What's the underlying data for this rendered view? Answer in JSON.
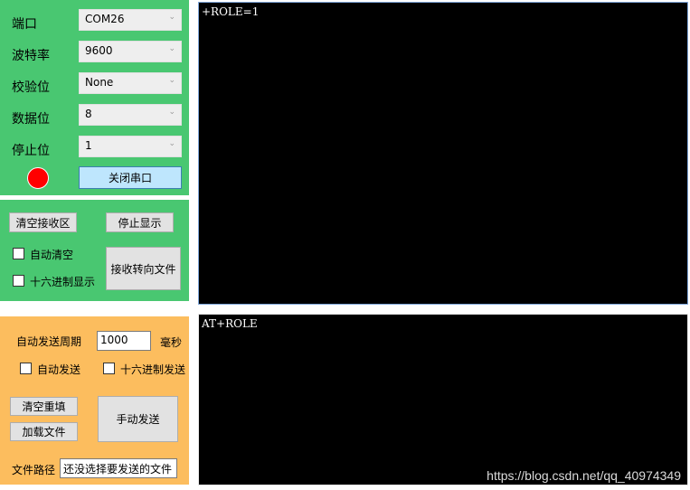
{
  "colors": {
    "panel_green": "#49c771",
    "panel_orange": "#fcbd5e",
    "terminal_bg": "#000000",
    "status_led": "#ff0000",
    "button_accent": "#bee6fd"
  },
  "port_settings": {
    "port": {
      "label": "端口",
      "value": "COM26"
    },
    "baud": {
      "label": "波特率",
      "value": "9600"
    },
    "parity": {
      "label": "校验位",
      "value": "None"
    },
    "data_bits": {
      "label": "数据位",
      "value": "8"
    },
    "stop_bits": {
      "label": "停止位",
      "value": "1"
    },
    "status_icon": "status-led-icon",
    "toggle_button": "关闭串口"
  },
  "receive": {
    "clear_button": "清空接收区",
    "stop_display_button": "停止显示",
    "auto_clear_label": "自动清空",
    "hex_display_label": "十六进制显示",
    "redirect_button": "接收转向文件",
    "output_text": "+ROLE=1"
  },
  "send": {
    "auto_period_label": "自动发送周期",
    "period_value": "1000",
    "period_unit": "毫秒",
    "auto_send_label": "自动发送",
    "hex_send_label": "十六进制发送",
    "clear_refill_button": "清空重填",
    "load_file_button": "加载文件",
    "manual_send_button": "手动发送",
    "file_path_label": "文件路径",
    "file_path_value": "还没选择要发送的文件",
    "input_text": "AT+ROLE"
  },
  "watermark": "https://blog.csdn.net/qq_40974349"
}
